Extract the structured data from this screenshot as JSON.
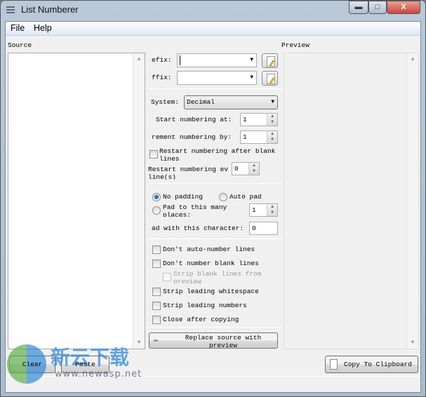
{
  "window": {
    "title": "List Numberer",
    "minimize": "▬",
    "maximize": "□",
    "close": "X"
  },
  "menu": [
    "File",
    "Help"
  ],
  "source": {
    "label": "Source",
    "value": ""
  },
  "preview": {
    "label": "Preview",
    "value": ""
  },
  "options": {
    "prefix_label": "efix:",
    "prefix_value": "",
    "suffix_label": "ffix:",
    "suffix_value": "",
    "system_label": "System:",
    "system_value": "Decimal",
    "start_label": "Start numbering at:",
    "start_value": "1",
    "increment_label": "rement numbering by:",
    "increment_value": "1",
    "restart_blank_label": "Restart numbering after blank lines",
    "restart_blank_checked": false,
    "restart_every_label": "Restart numbering ev line(s)",
    "restart_every_value": "0",
    "no_padding_label": "No padding",
    "auto_pad_label": "Auto pad",
    "padding_selected": "No padding",
    "pad_places_label": "Pad to this many places:",
    "pad_places_value": "1",
    "pad_char_label": "ad with this character:",
    "pad_char_value": "0",
    "checks": [
      {
        "label": "Don't auto-number lines",
        "checked": false
      },
      {
        "label": "Don't number blank lines",
        "checked": false
      },
      {
        "label": "Strip blank lines from preview",
        "checked": false,
        "disabled": true
      },
      {
        "label": "Strip leading whitespace",
        "checked": false
      },
      {
        "label": "Strip leading numbers",
        "checked": false
      },
      {
        "label": "Close after copying",
        "checked": false
      }
    ],
    "replace_button": "Replace source with preview"
  },
  "buttons": {
    "clear": "Clear",
    "paste": "Paste",
    "copy": "Copy To Clipboard"
  },
  "watermark": {
    "logo_text": "新云下载",
    "url": "www.newasp.net"
  },
  "colors": {
    "accent": "#2a6fb0",
    "close_button": "#c9463d"
  }
}
